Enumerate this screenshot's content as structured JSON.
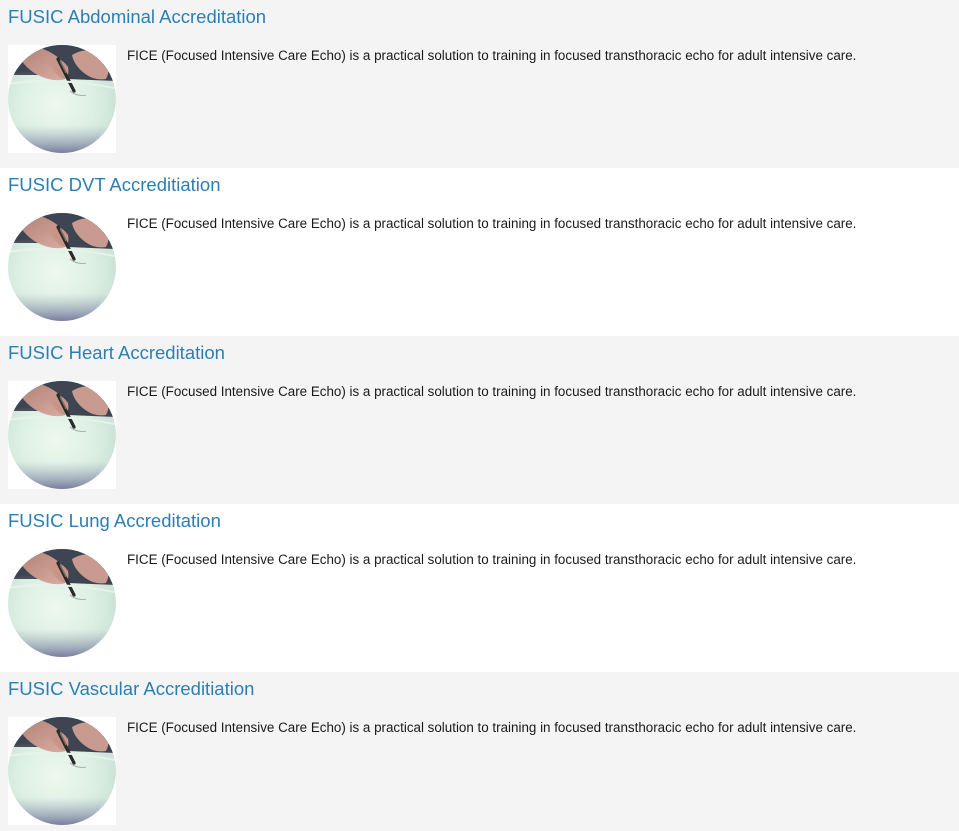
{
  "courses": [
    {
      "title": "FUSIC Abdominal Accreditation",
      "description": "FICE (Focused Intensive Care Echo) is a practical solution to training in focused transthoracic echo for adult intensive care.",
      "thumbnail": "hand-writing-with-pen-image"
    },
    {
      "title": "FUSIC DVT Accreditiation",
      "description": "FICE (Focused Intensive Care Echo) is a practical solution to training in focused transthoracic echo for adult intensive care.",
      "thumbnail": "hand-writing-with-pen-image"
    },
    {
      "title": "FUSIC Heart Accreditation",
      "description": "FICE (Focused Intensive Care Echo) is a practical solution to training in focused transthoracic echo for adult intensive care.",
      "thumbnail": "hand-writing-with-pen-image"
    },
    {
      "title": "FUSIC Lung Accreditation",
      "description": "FICE (Focused Intensive Care Echo) is a practical solution to training in focused transthoracic echo for adult intensive care.",
      "thumbnail": "hand-writing-with-pen-image"
    },
    {
      "title": "FUSIC Vascular Accreditiation",
      "description": "FICE (Focused Intensive Care Echo) is a practical solution to training in focused transthoracic echo for adult intensive care.",
      "thumbnail": "hand-writing-with-pen-image"
    }
  ],
  "colors": {
    "title_link": "#2c7fb3",
    "row_alt_background": "#f4f4f4",
    "row_background": "#ffffff",
    "body_text": "#1a1a1a"
  }
}
